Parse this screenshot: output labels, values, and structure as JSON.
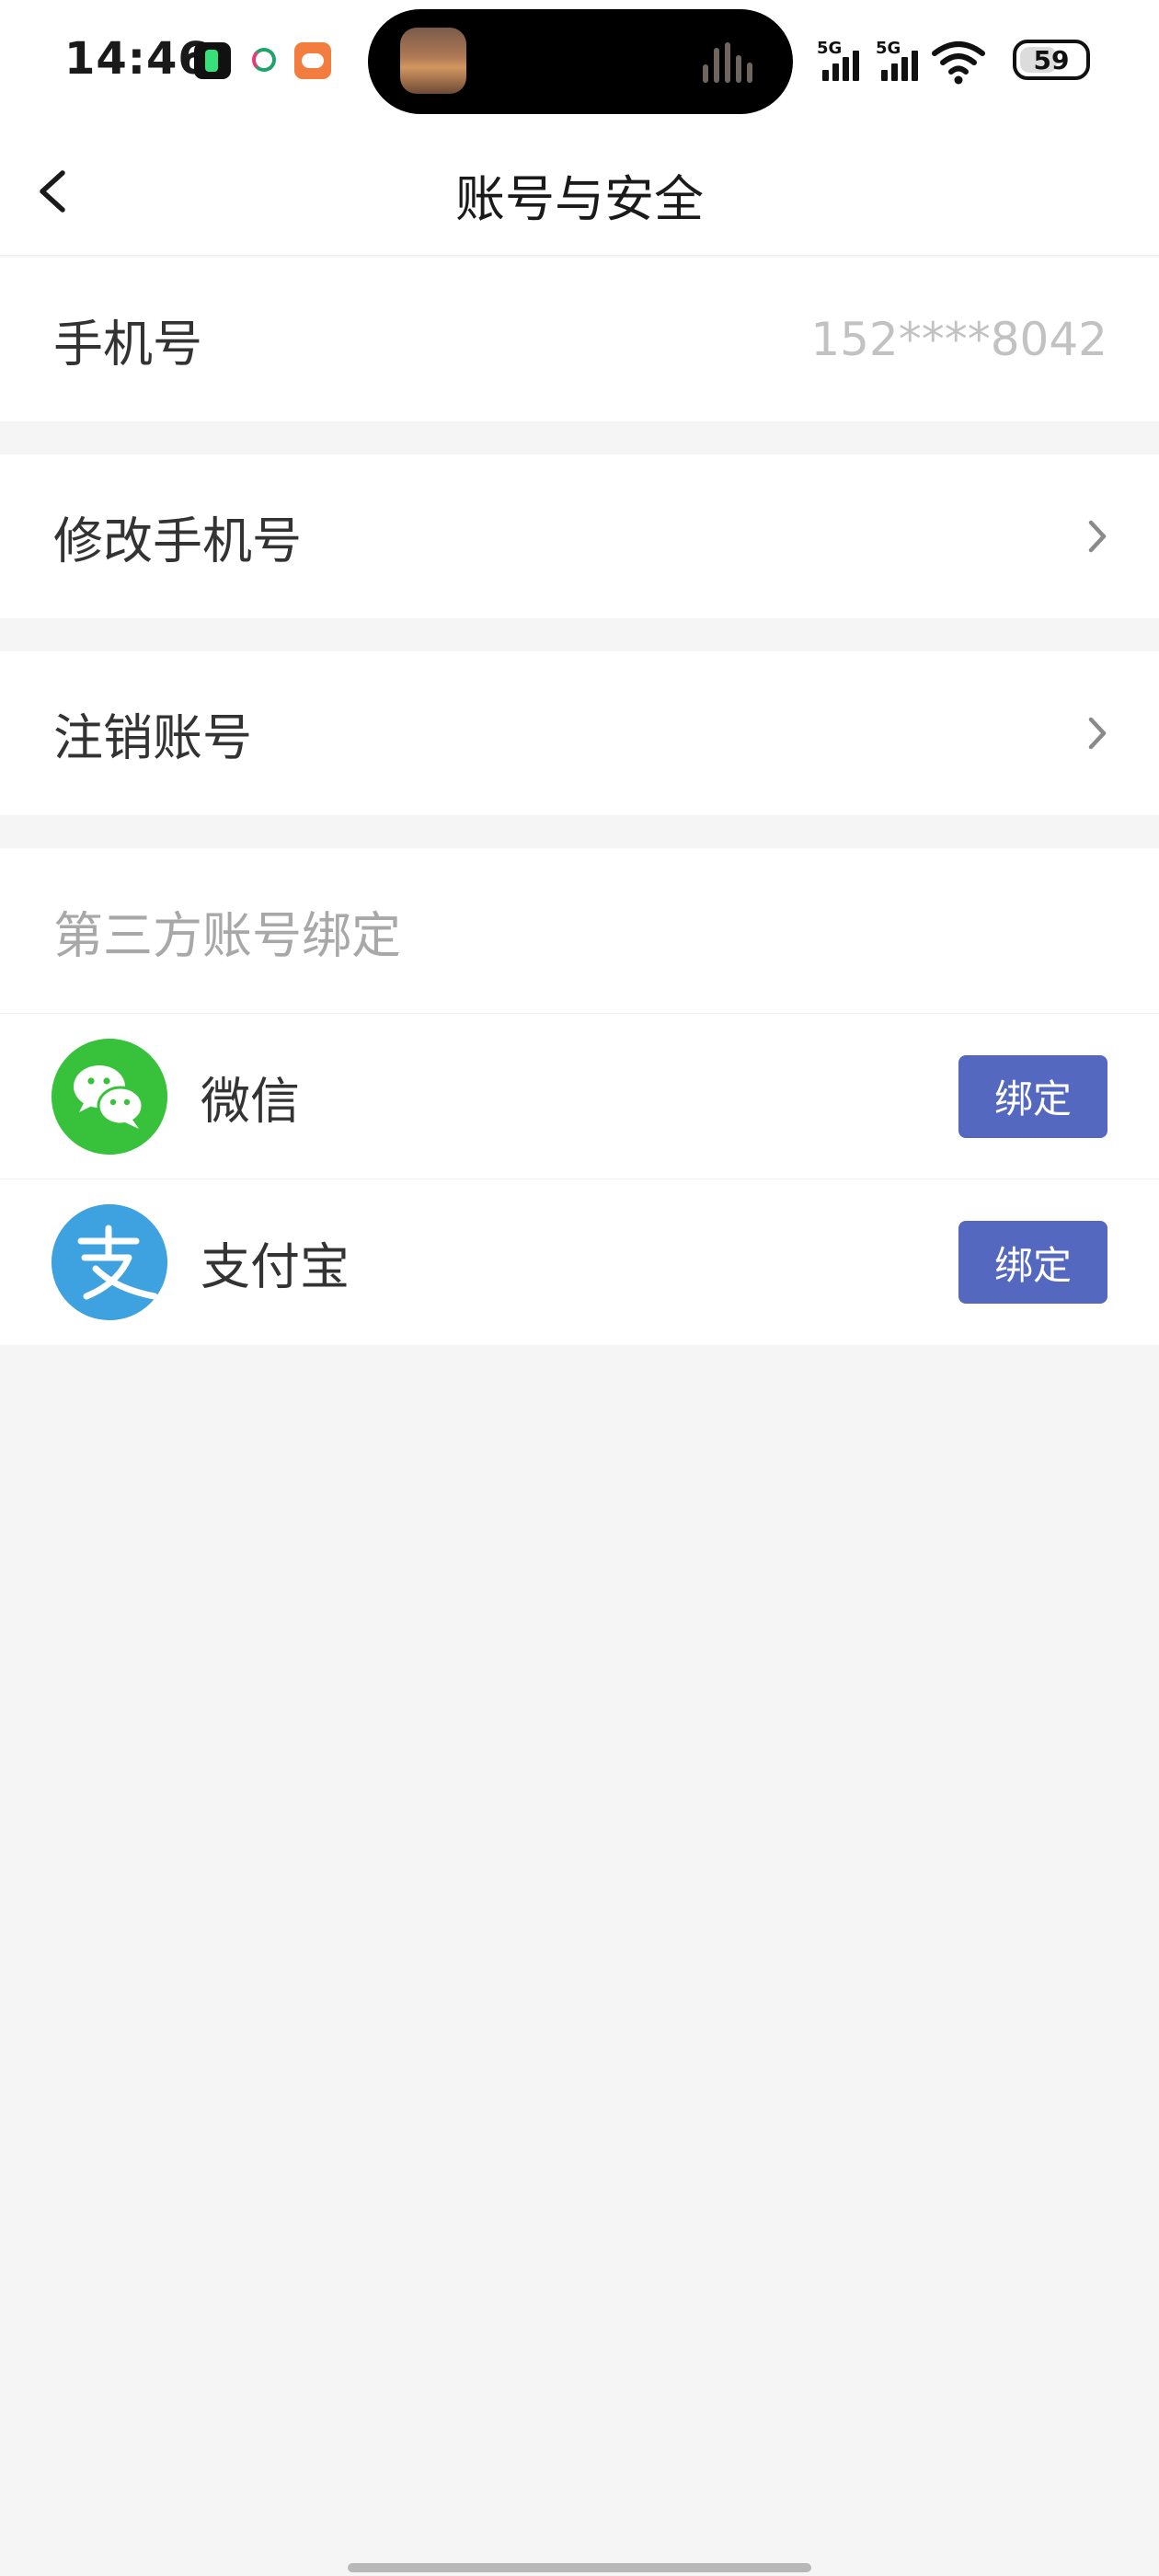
{
  "status_bar": {
    "time": "14:46",
    "network_1": "5G",
    "network_2": "5G",
    "battery_percent": 59,
    "battery_text": "59",
    "notification_icons": [
      "music-app-icon",
      "china-mobile-icon",
      "shopping-app-icon"
    ]
  },
  "nav": {
    "title": "账号与安全",
    "back_icon": "chevron-left-icon"
  },
  "account": {
    "phone_label": "手机号",
    "phone_value": "152****8042",
    "change_phone_label": "修改手机号",
    "close_account_label": "注销账号"
  },
  "third_party": {
    "header": "第三方账号绑定",
    "items": [
      {
        "name": "微信",
        "icon": "wechat-icon",
        "button_label": "绑定"
      },
      {
        "name": "支付宝",
        "icon": "alipay-icon",
        "button_label": "绑定"
      }
    ]
  },
  "colors": {
    "page_background": "#f5f5f5",
    "bind_button": "#5568c0",
    "wechat_green": "#38c23b",
    "alipay_blue": "#3ea1e0",
    "muted_text": "#a8a8a8"
  }
}
